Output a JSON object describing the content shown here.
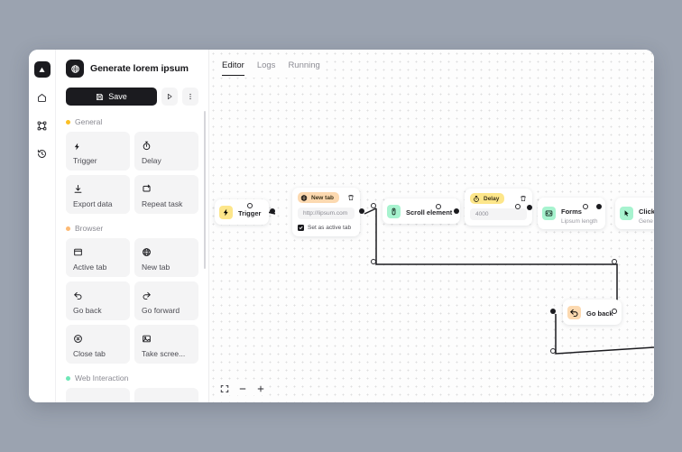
{
  "window": {
    "rail": {
      "logo_icon": "app-logo-triangle",
      "items": [
        {
          "icon": "home-icon",
          "name": "home"
        },
        {
          "icon": "workflow-nodes-icon",
          "name": "workflows"
        },
        {
          "icon": "history-clock-icon",
          "name": "history"
        }
      ]
    },
    "panel": {
      "flow_icon": "globe-icon",
      "flow_title": "Generate lorem ipsum",
      "save_label": "Save",
      "save_icon": "floppy-save-icon",
      "run_icon": "play-icon",
      "more_icon": "more-vertical-icon",
      "groups": [
        {
          "title": "General",
          "dot_color": "#fbbf24",
          "blocks": [
            {
              "label": "Trigger",
              "icon": "lightning-bolt-icon"
            },
            {
              "label": "Delay",
              "icon": "stopwatch-icon"
            },
            {
              "label": "Export data",
              "icon": "download-icon"
            },
            {
              "label": "Repeat task",
              "icon": "repeat-icon"
            }
          ]
        },
        {
          "title": "Browser",
          "dot_color": "#fdba74",
          "blocks": [
            {
              "label": "Active tab",
              "icon": "browser-window-icon"
            },
            {
              "label": "New tab",
              "icon": "globe-icon"
            },
            {
              "label": "Go back",
              "icon": "arrow-back-icon"
            },
            {
              "label": "Go forward",
              "icon": "arrow-forward-icon"
            },
            {
              "label": "Close tab",
              "icon": "close-circle-icon"
            },
            {
              "label": "Take scree...",
              "icon": "image-icon"
            }
          ]
        },
        {
          "title": "Web Interaction",
          "dot_color": "#6ee7b7",
          "blocks": [
            {
              "label": "",
              "icon": ""
            },
            {
              "label": "",
              "icon": ""
            }
          ]
        }
      ]
    },
    "canvas": {
      "tabs": [
        {
          "label": "Editor",
          "active": true
        },
        {
          "label": "Logs",
          "active": false
        },
        {
          "label": "Running",
          "active": false
        }
      ],
      "nodes": [
        {
          "id": "trigger",
          "kind": "simple",
          "label": "Trigger",
          "sub": "",
          "chip": "yellow",
          "icon": "lightning-bolt-icon"
        },
        {
          "id": "new-tab",
          "kind": "card",
          "badge": "New tab",
          "badge_color": "orange",
          "badge_icon": "globe-icon",
          "trash_icon": "trash-icon",
          "field_value": "http://lipsum.com",
          "check_label": "Set as active tab",
          "check_checked": true
        },
        {
          "id": "scroll-element",
          "kind": "simple",
          "label": "Scroll element",
          "sub": "",
          "chip": "green",
          "icon": "scroll-icon"
        },
        {
          "id": "delay",
          "kind": "card",
          "badge": "Delay",
          "badge_color": "yellow",
          "badge_icon": "stopwatch-icon",
          "trash_icon": "trash-icon",
          "field_value": "4000",
          "check_label": "",
          "check_checked": false
        },
        {
          "id": "forms",
          "kind": "simple",
          "label": "Forms",
          "sub": "Lipsum length",
          "chip": "green",
          "icon": "form-input-icon"
        },
        {
          "id": "click",
          "kind": "simple",
          "label": "Click",
          "sub": "Gene",
          "chip": "green",
          "icon": "cursor-click-icon"
        },
        {
          "id": "go-back",
          "kind": "simple",
          "label": "Go back",
          "sub": "",
          "chip": "orange",
          "icon": "arrow-back-icon"
        }
      ],
      "zoom_controls": {
        "fit_icon": "fit-to-screen-icon",
        "zoom_out_icon": "minus-icon",
        "zoom_in_icon": "plus-icon"
      }
    }
  },
  "colors": {
    "desktop_bg": "#9ba3b0",
    "window_bg": "#ffffff",
    "canvas_bg": "#fdfdfd",
    "accent_dark": "#1b1b1f",
    "chip_yellow": "#fde68a",
    "chip_green": "#a7f3cf",
    "chip_orange": "#fcd9b0",
    "wire": "#1b1b1f"
  }
}
